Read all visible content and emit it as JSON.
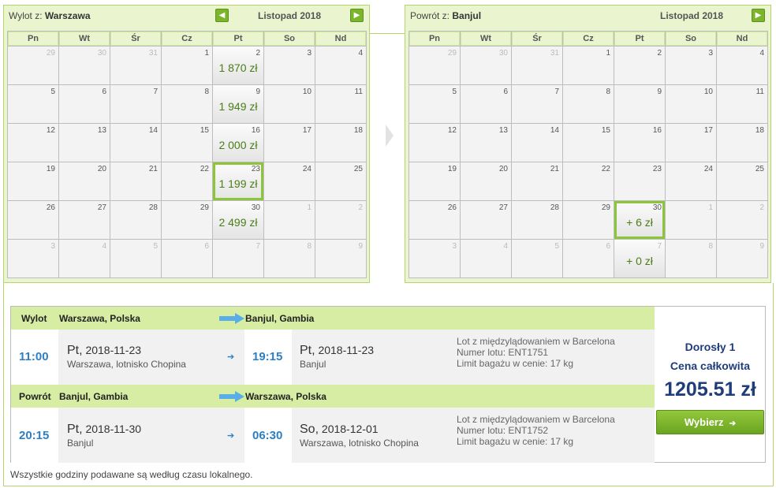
{
  "outbound_calendar": {
    "title_prefix": "Wylot z:",
    "title_city": "Warszawa",
    "month": "Listopad 2018",
    "weekdays": [
      "Pn",
      "Wt",
      "Śr",
      "Cz",
      "Pt",
      "So",
      "Nd"
    ],
    "weeks": [
      [
        {
          "d": "29",
          "o": true
        },
        {
          "d": "30",
          "o": true
        },
        {
          "d": "31",
          "o": true
        },
        {
          "d": "1"
        },
        {
          "d": "2",
          "p": "1 870 zł"
        },
        {
          "d": "3"
        },
        {
          "d": "4"
        }
      ],
      [
        {
          "d": "5"
        },
        {
          "d": "6"
        },
        {
          "d": "7"
        },
        {
          "d": "8"
        },
        {
          "d": "9",
          "p": "1 949 zł"
        },
        {
          "d": "10"
        },
        {
          "d": "11"
        }
      ],
      [
        {
          "d": "12"
        },
        {
          "d": "13"
        },
        {
          "d": "14"
        },
        {
          "d": "15"
        },
        {
          "d": "16",
          "p": "2 000 zł"
        },
        {
          "d": "17"
        },
        {
          "d": "18"
        }
      ],
      [
        {
          "d": "19"
        },
        {
          "d": "20"
        },
        {
          "d": "21"
        },
        {
          "d": "22"
        },
        {
          "d": "23",
          "p": "1 199 zł",
          "s": true
        },
        {
          "d": "24"
        },
        {
          "d": "25"
        }
      ],
      [
        {
          "d": "26"
        },
        {
          "d": "27"
        },
        {
          "d": "28"
        },
        {
          "d": "29"
        },
        {
          "d": "30",
          "p": "2 499 zł"
        },
        {
          "d": "1",
          "o": true
        },
        {
          "d": "2",
          "o": true
        }
      ],
      [
        {
          "d": "3",
          "o": true
        },
        {
          "d": "4",
          "o": true
        },
        {
          "d": "5",
          "o": true
        },
        {
          "d": "6",
          "o": true
        },
        {
          "d": "7",
          "o": true
        },
        {
          "d": "8",
          "o": true
        },
        {
          "d": "9",
          "o": true
        }
      ]
    ]
  },
  "return_calendar": {
    "title_prefix": "Powrót z:",
    "title_city": "Banjul",
    "month": "Listopad 2018",
    "weekdays": [
      "Pn",
      "Wt",
      "Śr",
      "Cz",
      "Pt",
      "So",
      "Nd"
    ],
    "weeks": [
      [
        {
          "d": "29",
          "o": true
        },
        {
          "d": "30",
          "o": true
        },
        {
          "d": "31",
          "o": true
        },
        {
          "d": "1"
        },
        {
          "d": "2"
        },
        {
          "d": "3"
        },
        {
          "d": "4"
        }
      ],
      [
        {
          "d": "5"
        },
        {
          "d": "6"
        },
        {
          "d": "7"
        },
        {
          "d": "8"
        },
        {
          "d": "9"
        },
        {
          "d": "10"
        },
        {
          "d": "11"
        }
      ],
      [
        {
          "d": "12"
        },
        {
          "d": "13"
        },
        {
          "d": "14"
        },
        {
          "d": "15"
        },
        {
          "d": "16"
        },
        {
          "d": "17"
        },
        {
          "d": "18"
        }
      ],
      [
        {
          "d": "19"
        },
        {
          "d": "20"
        },
        {
          "d": "21"
        },
        {
          "d": "22"
        },
        {
          "d": "23"
        },
        {
          "d": "24"
        },
        {
          "d": "25"
        }
      ],
      [
        {
          "d": "26"
        },
        {
          "d": "27"
        },
        {
          "d": "28"
        },
        {
          "d": "29"
        },
        {
          "d": "30",
          "p": "+ 6 zł",
          "s": true
        },
        {
          "d": "1",
          "o": true
        },
        {
          "d": "2",
          "o": true
        }
      ],
      [
        {
          "d": "3",
          "o": true
        },
        {
          "d": "4",
          "o": true
        },
        {
          "d": "5",
          "o": true
        },
        {
          "d": "6",
          "o": true
        },
        {
          "d": "7",
          "o": true,
          "p": "+ 0 zł"
        },
        {
          "d": "8",
          "o": true
        },
        {
          "d": "9",
          "o": true
        }
      ]
    ]
  },
  "outbound": {
    "label": "Wylot",
    "from": "Warszawa, Polska",
    "to": "Banjul, Gambia",
    "dep_time": "11:00",
    "dep_dw": "Pt,",
    "dep_date": "2018-11-23",
    "dep_place": "Warszawa, lotnisko Chopina",
    "arr_time": "19:15",
    "arr_dw": "Pt,",
    "arr_date": "2018-11-23",
    "arr_place": "Banjul",
    "detail1": "Lot z międzylądowaniem w Barcelona",
    "detail2": "Numer lotu: ENT1751",
    "detail3": "Limit bagażu w cenie: 17 kg"
  },
  "inbound": {
    "label": "Powrót",
    "from": "Banjul, Gambia",
    "to": "Warszawa, Polska",
    "dep_time": "20:15",
    "dep_dw": "Pt,",
    "dep_date": "2018-11-30",
    "dep_place": "Banjul",
    "arr_time": "06:30",
    "arr_dw": "So,",
    "arr_date": "2018-12-01",
    "arr_place": "Warszawa, lotnisko Chopina",
    "detail1": "Lot z międzylądowaniem w Barcelona",
    "detail2": "Numer lotu: ENT1752",
    "detail3": "Limit bagażu w cenie: 17 kg"
  },
  "price": {
    "passengers": "Dorosły 1",
    "total_label": "Cena całkowita",
    "amount": "1205.51 zł",
    "button": "Wybierz",
    "button_arrow": "➔"
  },
  "footnote": "Wszystkie godziny podawane są według czasu lokalnego.",
  "icons": {
    "prev": "◀",
    "next": "▶",
    "small_arrow": "➔"
  },
  "colors": {
    "accent_green": "#8cc43a",
    "time_blue": "#2c7fc4",
    "price_navy": "#1f3d7a"
  }
}
